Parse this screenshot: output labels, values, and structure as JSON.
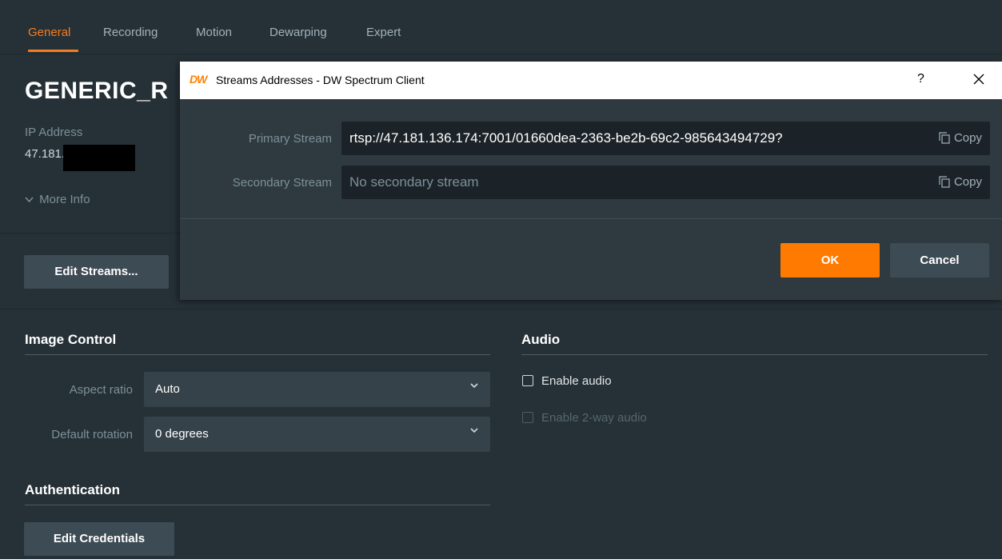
{
  "tabs": [
    {
      "label": "General",
      "active": true
    },
    {
      "label": "Recording",
      "active": false
    },
    {
      "label": "Motion",
      "active": false
    },
    {
      "label": "Dewarping",
      "active": false
    },
    {
      "label": "Expert",
      "active": false
    }
  ],
  "camera": {
    "name": "GENERIC_R",
    "ip_label": "IP Address",
    "ip_value": "47.181.",
    "more_info": "More Info",
    "edit_streams": "Edit Streams..."
  },
  "image_control": {
    "title": "Image Control",
    "aspect_ratio_label": "Aspect ratio",
    "aspect_ratio_value": "Auto",
    "rotation_label": "Default rotation",
    "rotation_value": "0 degrees"
  },
  "authentication": {
    "title": "Authentication",
    "edit_credentials": "Edit Credentials"
  },
  "audio": {
    "title": "Audio",
    "enable_audio": "Enable audio",
    "enable_audio_checked": false,
    "enable_2way": "Enable 2-way audio",
    "enable_2way_enabled": false
  },
  "dialog": {
    "logo": "DW",
    "title": "Streams Addresses - DW Spectrum Client",
    "help": "?",
    "primary_label": "Primary Stream",
    "primary_value": "rtsp://47.181.136.174:7001/01660dea-2363-be2b-69c2-985643494729?",
    "secondary_label": "Secondary Stream",
    "secondary_value": "No secondary stream",
    "copy_label": "Copy",
    "ok_label": "OK",
    "cancel_label": "Cancel"
  },
  "colors": {
    "accent": "#f77c1f",
    "background": "#263137",
    "ok_button": "#ff7a00"
  }
}
